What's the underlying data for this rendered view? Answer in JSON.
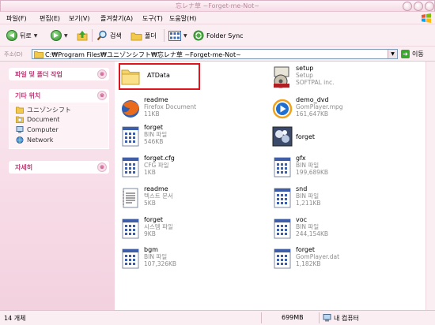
{
  "window": {
    "title": "忘レナ草 ~Forget-me-Not~"
  },
  "menu": [
    "파일(F)",
    "편집(E)",
    "보기(V)",
    "즐겨찾기(A)",
    "도구(T)",
    "도움말(H)"
  ],
  "toolbar": {
    "back": "뒤로",
    "search": "검색",
    "folders": "폴더",
    "folder_sync": "Folder Sync"
  },
  "address": {
    "label": "주소(D)",
    "path": "C:₩Program Files₩ユニゾンシフト₩忘レナ草 ~Forget-me-Not~",
    "go": "이동"
  },
  "taskpane": {
    "file_tasks": "파일 및 폴더 작업",
    "other_places": "기타 위치",
    "other_items": [
      {
        "label": "ユニゾンシフト",
        "icon": "folder-icon"
      },
      {
        "label": "Document",
        "icon": "documents-icon"
      },
      {
        "label": "Computer",
        "icon": "computer-icon"
      },
      {
        "label": "Network",
        "icon": "network-icon"
      }
    ],
    "details": "자세히"
  },
  "files": {
    "atdata": {
      "name": "ATData"
    },
    "setup": {
      "name": "setup",
      "type": "Setup",
      "size": "SOFTPAL inc."
    },
    "readme_ff": {
      "name": "readme",
      "type": "Firefox Document",
      "size": "11KB"
    },
    "demo_dvd": {
      "name": "demo_dvd",
      "type": "GomPlayer.mpg",
      "size": "161,647KB"
    },
    "forget_bin": {
      "name": "forget",
      "type": "BIN 파일",
      "size": "546KB"
    },
    "forget_exe": {
      "name": "forget"
    },
    "forget_cfg": {
      "name": "forget.cfg",
      "type": "CFG 파일",
      "size": "1KB"
    },
    "gfx": {
      "name": "gfx",
      "type": "BIN 파일",
      "size": "199,689KB"
    },
    "readme_txt": {
      "name": "readme",
      "type": "텍스트 문서",
      "size": "5KB"
    },
    "snd": {
      "name": "snd",
      "type": "BIN 파일",
      "size": "1,211KB"
    },
    "forget_sys": {
      "name": "forget",
      "type": "시스템 파일",
      "size": "9KB"
    },
    "voc": {
      "name": "voc",
      "type": "BIN 파일",
      "size": "244,154KB"
    },
    "bgm": {
      "name": "bgm",
      "type": "BIN 파일",
      "size": "107,326KB"
    },
    "forget_dat": {
      "name": "forget",
      "type": "GomPlayer.dat",
      "size": "1,182KB"
    }
  },
  "status": {
    "objects": "14 개체",
    "size": "699MB",
    "location": "내 컴퓨터"
  },
  "colors": {
    "accent": "#c23a77",
    "highlight_box": "#e0141f",
    "chrome": "#fbeef3"
  }
}
